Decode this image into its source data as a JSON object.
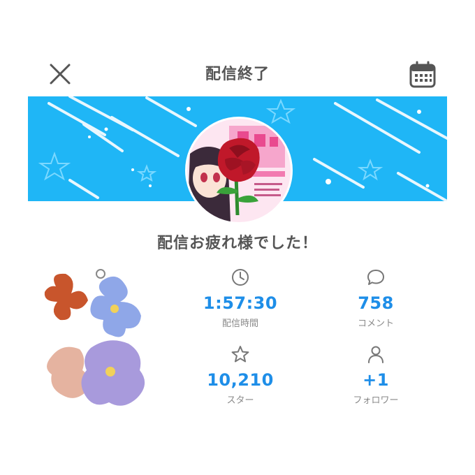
{
  "header": {
    "title": "配信終了"
  },
  "icons": {
    "close": "close-icon",
    "calendar": "calendar-icon"
  },
  "message": "配信お疲れ様でした！",
  "stats": {
    "duration": {
      "value": "1:57:30",
      "label": "配信時間",
      "icon": "clock-icon"
    },
    "comments": {
      "value": "758",
      "label": "コメント",
      "icon": "speech-bubble-icon"
    },
    "stars": {
      "value": "10,210",
      "label": "スター",
      "icon": "star-icon"
    },
    "followers": {
      "value": "+1",
      "label": "フォロワー",
      "icon": "person-icon"
    }
  },
  "colors": {
    "banner": "#1fb6f6",
    "accent_value": "#1e8ee8",
    "rose": "#c0182a"
  }
}
